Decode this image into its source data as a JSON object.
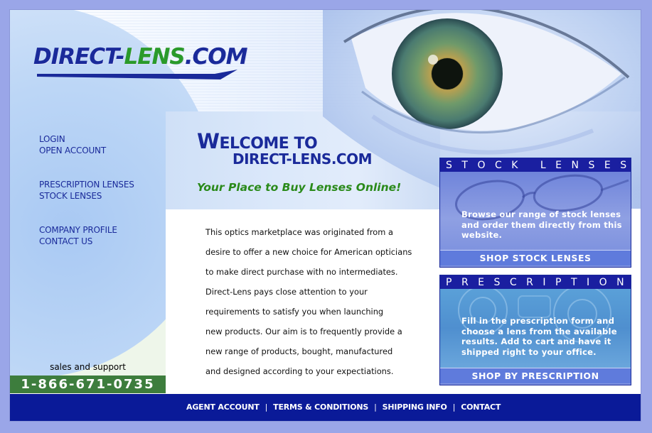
{
  "header": {
    "logo_part1": "DIRECT-",
    "logo_part2": "LENS",
    "logo_part3": ".COM"
  },
  "nav": {
    "group1": [
      "LOGIN",
      "OPEN ACCOUNT"
    ],
    "group2": [
      "PRESCRIPTION LENSES",
      "STOCK LENSES"
    ],
    "group3": [
      "COMPANY PROFILE",
      "CONTACT US"
    ]
  },
  "support": {
    "label": "sales and support",
    "phone": "1-866-671-0735"
  },
  "welcome": {
    "line1_cap": "W",
    "line1_rest": "ELCOME TO",
    "line2": "DIRECT-LENS.COM",
    "tagline": "Your Place to Buy Lenses Online!"
  },
  "content": {
    "lines": [
      "This optics marketplace was originated from a",
      "desire to offer a new choice for American opticians",
      "to make direct purchase with no intermediates.",
      "Direct-Lens pays close attention to your",
      "requirements to satisfy you when launching",
      "new products. Our aim is to frequently provide a",
      "new range of products, bought, manufactured",
      "and designed according to your expectiations."
    ]
  },
  "panels": {
    "stock": {
      "title": "STOCK LENSES",
      "text": "Browse our range of stock lenses and order them directly from this website.",
      "button": "SHOP STOCK LENSES"
    },
    "prescription": {
      "title": "PRESCRIPTION",
      "text": "Fill in the prescription form and choose a lens from the available results. Add to cart and have it shipped right to your office.",
      "button": "SHOP BY PRESCRIPTION"
    }
  },
  "footer": {
    "links": [
      "AGENT ACCOUNT",
      "TERMS & CONDITIONS",
      "SHIPPING INFO",
      "CONTACT"
    ],
    "separator": "|"
  },
  "colors": {
    "brand_blue": "#1a2a9a",
    "brand_green": "#2a9a2a",
    "footer_bg": "#0a1a98",
    "phone_bg": "#3d7d3d"
  }
}
